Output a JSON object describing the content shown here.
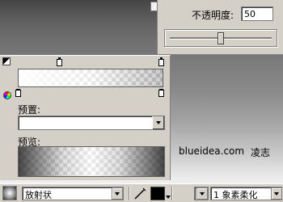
{
  "opacity_popup": {
    "label": "不透明度:",
    "value": "50",
    "slider_level_percent": 50
  },
  "gradient_editor": {
    "preset_label": "预置:",
    "preset_value": "",
    "preview_label": "预览:",
    "corner_icon": "swap-colors-icon",
    "wheel_icon": "color-wheel-icon"
  },
  "watermark": {
    "site": "blueidea.com",
    "author": "凌志"
  },
  "toolbar": {
    "fill_type": "放射状",
    "edge_value": "1",
    "edge_type": "1 象素柔化",
    "pen_icon": "pencil-icon",
    "fill_color": "#000000"
  }
}
